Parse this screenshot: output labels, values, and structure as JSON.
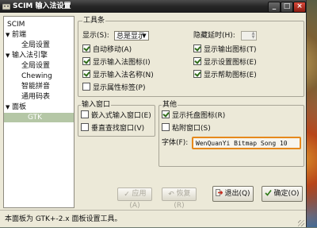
{
  "window": {
    "title": "SCIM 输入法设置",
    "controls": {
      "minimize": "_",
      "maximize": "□",
      "close": "×"
    }
  },
  "sidebar": {
    "items": [
      {
        "label": "SCIM",
        "expanded": null,
        "selected": false
      },
      {
        "label": "前端",
        "expanded": true,
        "selected": false
      },
      {
        "label": "全局设置",
        "expanded": null,
        "selected": false
      },
      {
        "label": "输入法引擎",
        "expanded": true,
        "selected": false
      },
      {
        "label": "全局设置",
        "expanded": null,
        "selected": false
      },
      {
        "label": "Chewing",
        "expanded": null,
        "selected": false
      },
      {
        "label": "智能拼音",
        "expanded": null,
        "selected": false
      },
      {
        "label": "通用码表",
        "expanded": null,
        "selected": false
      },
      {
        "label": "面板",
        "expanded": true,
        "selected": false
      },
      {
        "label": "GTK",
        "expanded": null,
        "selected": true
      }
    ]
  },
  "toolbar_group": {
    "title": "工具条",
    "show_label": "显示(S):",
    "show_value": "总是显示",
    "autohide_label": "隐藏延时(H):",
    "autohide_value": "",
    "options": [
      {
        "label": "自动移动(A)",
        "checked": true
      },
      {
        "label": "显示输入法图标(I)",
        "checked": true
      },
      {
        "label": "显示输入法名称(N)",
        "checked": true
      },
      {
        "label": "显示属性标签(P)",
        "checked": false
      },
      {
        "label": "显示输出图标(T)",
        "checked": true
      },
      {
        "label": "显示设置图标(E)",
        "checked": true
      },
      {
        "label": "显示帮助图标(E)",
        "checked": true
      }
    ]
  },
  "lookup_group": {
    "title": "输入窗口",
    "options": [
      {
        "label": "嵌入式输入窗口(E)",
        "checked": false
      },
      {
        "label": "垂直查找窗口(V)",
        "checked": false
      }
    ]
  },
  "misc_group": {
    "title": "其他",
    "options": [
      {
        "label": "显示托盘图标(R)",
        "checked": true
      },
      {
        "label": "粘附窗口(S)",
        "checked": false
      }
    ],
    "font_label": "字体(F):",
    "font_value": "WenQuanYi Bitmap Song 10"
  },
  "buttons": {
    "apply": "应用(A)",
    "restore": "恢复(R)",
    "exit": "退出(Q)",
    "confirm": "确定(O)"
  },
  "status": "本面板为 GTK+-2.x 面板设置工具。",
  "colors": {
    "titlebar": "#262626",
    "selection": "#b5c7a6",
    "font_button_border": "#e6891c",
    "exit_icon": "#c62b1d",
    "confirm_icon": "#2f7a17"
  }
}
